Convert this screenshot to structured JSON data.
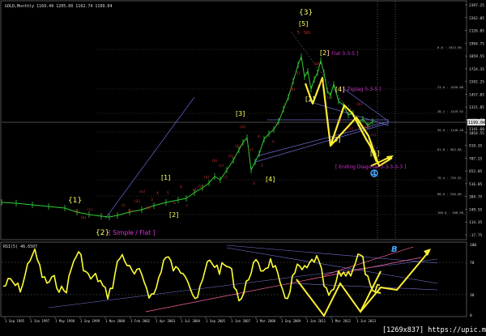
{
  "window": {
    "header_text": "GOLD,Monthly  1169.40 1205.60 1162.74 1199.04",
    "watermark": "[1269x837] https://upic.me/"
  },
  "colors": {
    "background": "#000000",
    "price": "#33cc33",
    "rsi": "#ffff33",
    "wave_main": "#ffff66",
    "wave_sub": "#cc3333",
    "annotation": "#cc33cc",
    "trendline": "#6666cc",
    "grid": "#444444"
  },
  "price_axis": {
    "ticks": [
      "2397.25",
      "2262.05",
      "2126.85",
      "1994.75",
      "1859.55",
      "1724.35",
      "1592.25",
      "1457.05",
      "1321.85",
      "1189.75",
      "1054.55",
      "919.35",
      "787.25",
      "652.05",
      "516.85",
      "384.75",
      "249.55",
      "114.35",
      "-17.75"
    ],
    "current": "1199.04",
    "marker": "1141.60"
  },
  "fib_labels": [
    "0.0 · 1923.90",
    "23.6 · 1556.88",
    "38.2 · 1329.92",
    "50.0 · 1146.40",
    "61.8 · 962.88",
    "76.4 · 735.92",
    "88.6 · 546.00",
    "100.0 · 368.90"
  ],
  "rsi_panel": {
    "label": "RSI(5) 46.6507",
    "axis_ticks": [
      "100",
      "70",
      "30",
      "0"
    ]
  },
  "time_axis": {
    "labels": [
      "1 Sep 1995",
      "1 Jan 1997",
      "1 May 1998",
      "1 Sep 1999",
      "1 Nov 2000",
      "1 Feb 2002",
      "1 Apr 2003",
      "1 Jul 2004",
      "1 Sep 2005",
      "1 Jan 2007",
      "1 Mar 2008",
      "1 Sep 2009",
      "1 Jan 2011",
      "1 Mar 2012",
      "1 Jun 2013"
    ]
  },
  "annotations": {
    "w1": "{1}",
    "w2": "{2}",
    "w2_desc": "[ Simple / Flat ]",
    "w3": "{3}",
    "w3_sub": "[5]",
    "w3_sub2": "5 · 5th",
    "b_1": "[1]",
    "b_2": "[2]",
    "b_3": "[3]",
    "b_4": "[4]",
    "top_1": "[1]",
    "top_2": "[2]",
    "top_3": "[3]",
    "top_4": "[4]",
    "top_5": "[5]",
    "flat": "[ Flat 3-3-5 ]",
    "zigzag": "[ Zigzag 5-3-5 ]",
    "ending": "[ Ending Diagonal 3-3-3-3-3 ]",
    "w4_mark": "4",
    "rsi_b": "B",
    "sub_marks": [
      "(a)",
      "(b)",
      "(c)",
      "(i)",
      "(ii)",
      "(iii)",
      "(iv)",
      "(v)",
      "3",
      "4",
      "5",
      "a",
      "b",
      "c",
      "(4)",
      "(5)"
    ]
  }
}
